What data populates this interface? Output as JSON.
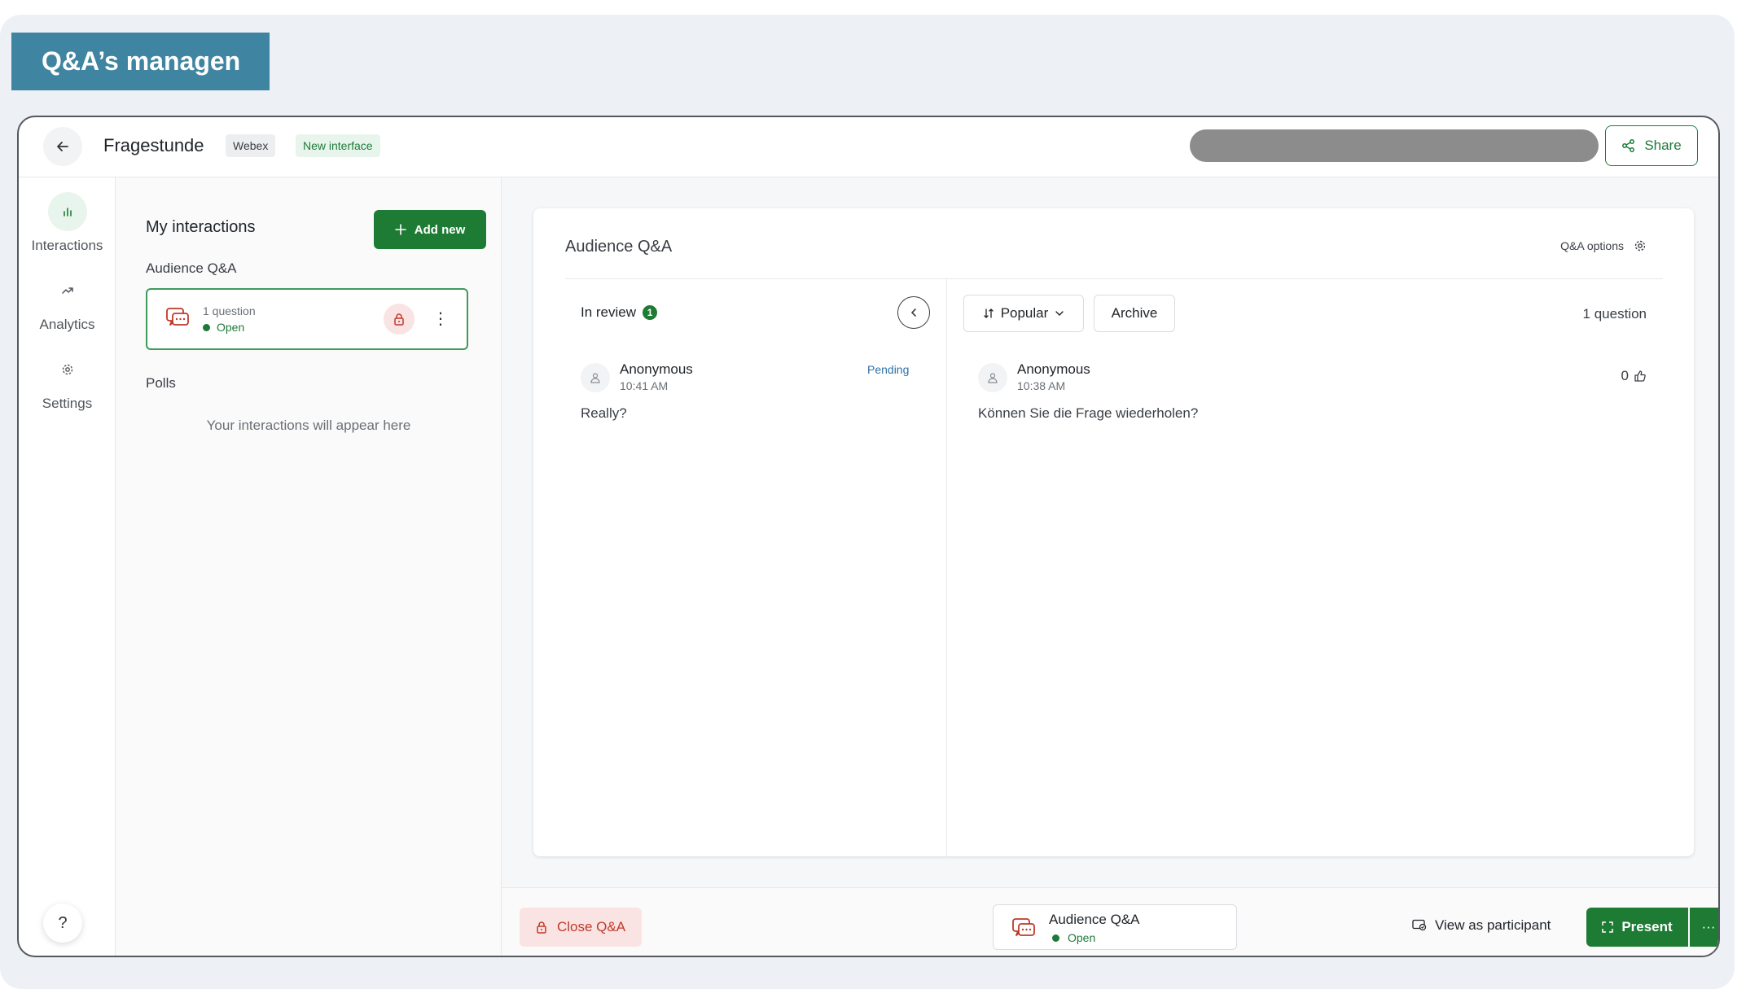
{
  "banner": {
    "title": "Q&A’s managen"
  },
  "header": {
    "title": "Fragestunde",
    "badge_platform": "Webex",
    "badge_new": "New interface",
    "share_label": "Share"
  },
  "rail": {
    "items": [
      {
        "label": "Interactions",
        "icon": "bar-chart-icon"
      },
      {
        "label": "Analytics",
        "icon": "trend-icon"
      },
      {
        "label": "Settings",
        "icon": "gear-icon"
      }
    ],
    "help_label": "?"
  },
  "panel": {
    "title": "My interactions",
    "add_label": "Add new",
    "qa_section": "Audience Q&A",
    "qa_card": {
      "count": "1 question",
      "status": "Open"
    },
    "polls_section": "Polls",
    "empty_text": "Your interactions will appear here"
  },
  "main": {
    "card_title": "Audience Q&A",
    "options_label": "Q&A options",
    "review": {
      "label": "In review",
      "count": "1",
      "question": {
        "name": "Anonymous",
        "time": "10:41 AM",
        "status": "Pending",
        "text": "Really?"
      }
    },
    "live": {
      "sort_label": "Popular",
      "archive_label": "Archive",
      "question_count": "1 question",
      "question": {
        "name": "Anonymous",
        "time": "10:38 AM",
        "votes": "0",
        "text": "Können Sie die Frage wiederholen?"
      }
    }
  },
  "bottom": {
    "close_label": "Close Q&A",
    "chip_title": "Audience Q&A",
    "chip_status": "Open",
    "view_label": "View as participant",
    "present_label": "Present",
    "more_label": "···"
  },
  "colors": {
    "accent": "#1e7b34",
    "banner": "#3f84a0",
    "danger": "#c0392b",
    "pending": "#2f6fa6"
  }
}
